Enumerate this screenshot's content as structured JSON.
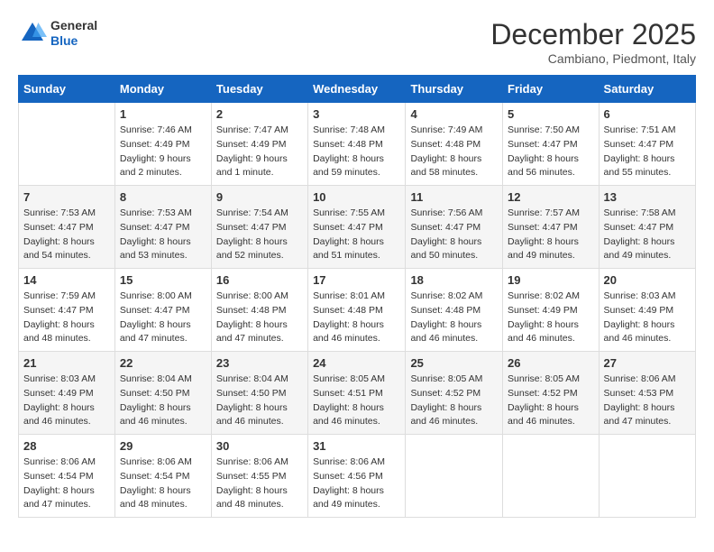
{
  "header": {
    "logo_general": "General",
    "logo_blue": "Blue",
    "month_title": "December 2025",
    "location": "Cambiano, Piedmont, Italy"
  },
  "days_of_week": [
    "Sunday",
    "Monday",
    "Tuesday",
    "Wednesday",
    "Thursday",
    "Friday",
    "Saturday"
  ],
  "weeks": [
    [
      {
        "day": "",
        "info": ""
      },
      {
        "day": "1",
        "info": "Sunrise: 7:46 AM\nSunset: 4:49 PM\nDaylight: 9 hours\nand 2 minutes."
      },
      {
        "day": "2",
        "info": "Sunrise: 7:47 AM\nSunset: 4:49 PM\nDaylight: 9 hours\nand 1 minute."
      },
      {
        "day": "3",
        "info": "Sunrise: 7:48 AM\nSunset: 4:48 PM\nDaylight: 8 hours\nand 59 minutes."
      },
      {
        "day": "4",
        "info": "Sunrise: 7:49 AM\nSunset: 4:48 PM\nDaylight: 8 hours\nand 58 minutes."
      },
      {
        "day": "5",
        "info": "Sunrise: 7:50 AM\nSunset: 4:47 PM\nDaylight: 8 hours\nand 56 minutes."
      },
      {
        "day": "6",
        "info": "Sunrise: 7:51 AM\nSunset: 4:47 PM\nDaylight: 8 hours\nand 55 minutes."
      }
    ],
    [
      {
        "day": "7",
        "info": "Sunrise: 7:53 AM\nSunset: 4:47 PM\nDaylight: 8 hours\nand 54 minutes."
      },
      {
        "day": "8",
        "info": "Sunrise: 7:53 AM\nSunset: 4:47 PM\nDaylight: 8 hours\nand 53 minutes."
      },
      {
        "day": "9",
        "info": "Sunrise: 7:54 AM\nSunset: 4:47 PM\nDaylight: 8 hours\nand 52 minutes."
      },
      {
        "day": "10",
        "info": "Sunrise: 7:55 AM\nSunset: 4:47 PM\nDaylight: 8 hours\nand 51 minutes."
      },
      {
        "day": "11",
        "info": "Sunrise: 7:56 AM\nSunset: 4:47 PM\nDaylight: 8 hours\nand 50 minutes."
      },
      {
        "day": "12",
        "info": "Sunrise: 7:57 AM\nSunset: 4:47 PM\nDaylight: 8 hours\nand 49 minutes."
      },
      {
        "day": "13",
        "info": "Sunrise: 7:58 AM\nSunset: 4:47 PM\nDaylight: 8 hours\nand 49 minutes."
      }
    ],
    [
      {
        "day": "14",
        "info": "Sunrise: 7:59 AM\nSunset: 4:47 PM\nDaylight: 8 hours\nand 48 minutes."
      },
      {
        "day": "15",
        "info": "Sunrise: 8:00 AM\nSunset: 4:47 PM\nDaylight: 8 hours\nand 47 minutes."
      },
      {
        "day": "16",
        "info": "Sunrise: 8:00 AM\nSunset: 4:48 PM\nDaylight: 8 hours\nand 47 minutes."
      },
      {
        "day": "17",
        "info": "Sunrise: 8:01 AM\nSunset: 4:48 PM\nDaylight: 8 hours\nand 46 minutes."
      },
      {
        "day": "18",
        "info": "Sunrise: 8:02 AM\nSunset: 4:48 PM\nDaylight: 8 hours\nand 46 minutes."
      },
      {
        "day": "19",
        "info": "Sunrise: 8:02 AM\nSunset: 4:49 PM\nDaylight: 8 hours\nand 46 minutes."
      },
      {
        "day": "20",
        "info": "Sunrise: 8:03 AM\nSunset: 4:49 PM\nDaylight: 8 hours\nand 46 minutes."
      }
    ],
    [
      {
        "day": "21",
        "info": "Sunrise: 8:03 AM\nSunset: 4:49 PM\nDaylight: 8 hours\nand 46 minutes."
      },
      {
        "day": "22",
        "info": "Sunrise: 8:04 AM\nSunset: 4:50 PM\nDaylight: 8 hours\nand 46 minutes."
      },
      {
        "day": "23",
        "info": "Sunrise: 8:04 AM\nSunset: 4:50 PM\nDaylight: 8 hours\nand 46 minutes."
      },
      {
        "day": "24",
        "info": "Sunrise: 8:05 AM\nSunset: 4:51 PM\nDaylight: 8 hours\nand 46 minutes."
      },
      {
        "day": "25",
        "info": "Sunrise: 8:05 AM\nSunset: 4:52 PM\nDaylight: 8 hours\nand 46 minutes."
      },
      {
        "day": "26",
        "info": "Sunrise: 8:05 AM\nSunset: 4:52 PM\nDaylight: 8 hours\nand 46 minutes."
      },
      {
        "day": "27",
        "info": "Sunrise: 8:06 AM\nSunset: 4:53 PM\nDaylight: 8 hours\nand 47 minutes."
      }
    ],
    [
      {
        "day": "28",
        "info": "Sunrise: 8:06 AM\nSunset: 4:54 PM\nDaylight: 8 hours\nand 47 minutes."
      },
      {
        "day": "29",
        "info": "Sunrise: 8:06 AM\nSunset: 4:54 PM\nDaylight: 8 hours\nand 48 minutes."
      },
      {
        "day": "30",
        "info": "Sunrise: 8:06 AM\nSunset: 4:55 PM\nDaylight: 8 hours\nand 48 minutes."
      },
      {
        "day": "31",
        "info": "Sunrise: 8:06 AM\nSunset: 4:56 PM\nDaylight: 8 hours\nand 49 minutes."
      },
      {
        "day": "",
        "info": ""
      },
      {
        "day": "",
        "info": ""
      },
      {
        "day": "",
        "info": ""
      }
    ]
  ]
}
